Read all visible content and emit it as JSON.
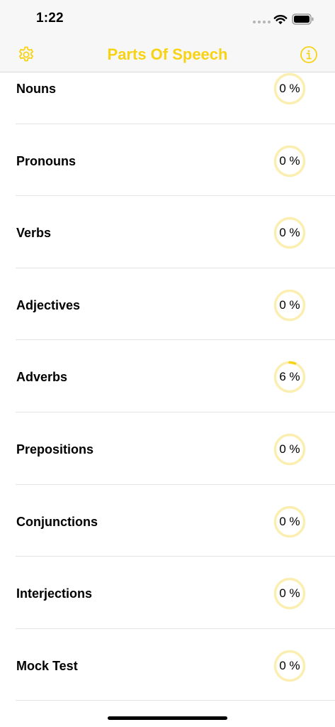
{
  "status_bar": {
    "time": "1:22"
  },
  "nav": {
    "title": "Parts Of Speech",
    "accent_color": "#f8d214"
  },
  "colors": {
    "ring_track": "#fbeeb1",
    "ring_fill": "#f8d214"
  },
  "items": [
    {
      "label": "Nouns",
      "progress_text": "0 %",
      "progress": 0
    },
    {
      "label": "Pronouns",
      "progress_text": "0 %",
      "progress": 0
    },
    {
      "label": "Verbs",
      "progress_text": "0 %",
      "progress": 0
    },
    {
      "label": "Adjectives",
      "progress_text": "0 %",
      "progress": 0
    },
    {
      "label": "Adverbs",
      "progress_text": "6 %",
      "progress": 6
    },
    {
      "label": "Prepositions",
      "progress_text": "0 %",
      "progress": 0
    },
    {
      "label": "Conjunctions",
      "progress_text": "0 %",
      "progress": 0
    },
    {
      "label": "Interjections",
      "progress_text": "0 %",
      "progress": 0
    },
    {
      "label": "Mock Test",
      "progress_text": "0 %",
      "progress": 0
    }
  ]
}
